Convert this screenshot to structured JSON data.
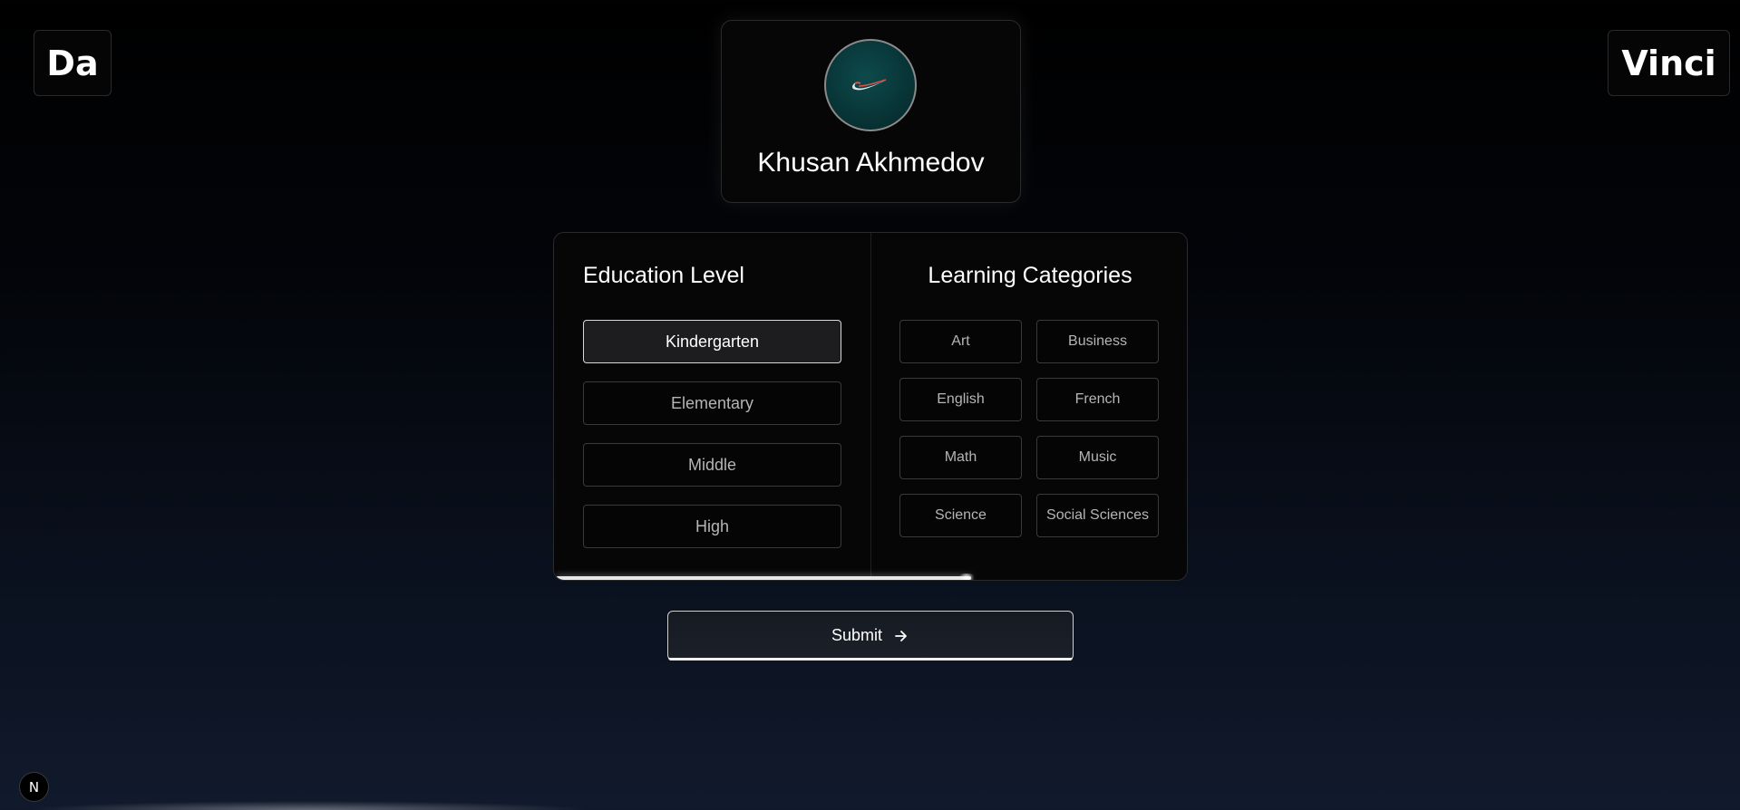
{
  "brand": {
    "left_text": "Da",
    "right_text": "Vinci"
  },
  "profile": {
    "name": "Khusan Akhmedov",
    "avatar_icon": "swoosh-logo-icon"
  },
  "education": {
    "title": "Education Level",
    "options": [
      "Kindergarten",
      "Elementary",
      "Middle",
      "High"
    ],
    "selected": "Kindergarten"
  },
  "categories": {
    "title": "Learning Categories",
    "options": [
      "Art",
      "Business",
      "English",
      "French",
      "Math",
      "Music",
      "Science",
      "Social Sciences"
    ]
  },
  "progress": {
    "fraction": 0.66
  },
  "submit": {
    "label": "Submit",
    "icon": "arrow-right-icon"
  },
  "dev_badge": {
    "text": "N"
  },
  "colors": {
    "background_top": "#000000",
    "background_bottom": "#111a2c",
    "accent": "#ffffff",
    "border": "#2a2a2a"
  }
}
